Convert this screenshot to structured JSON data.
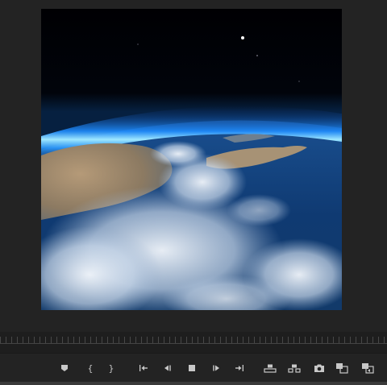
{
  "app": {
    "panel": "program-monitor"
  },
  "controls": {
    "add_marker": "add-marker",
    "mark_in": "{",
    "mark_out": "}",
    "go_to_in": "go-to-in",
    "step_back": "step-back",
    "stop": "stop",
    "step_forward": "step-forward",
    "go_to_out": "go-to-out",
    "lift": "lift",
    "extract": "extract",
    "export_frame": "camera",
    "compare_view": "compare",
    "multi_camera": "multi-camera"
  },
  "colors": {
    "panel_bg": "#232323",
    "icon": "#c8c8c8",
    "atmosphere": "#1fa3ff"
  }
}
